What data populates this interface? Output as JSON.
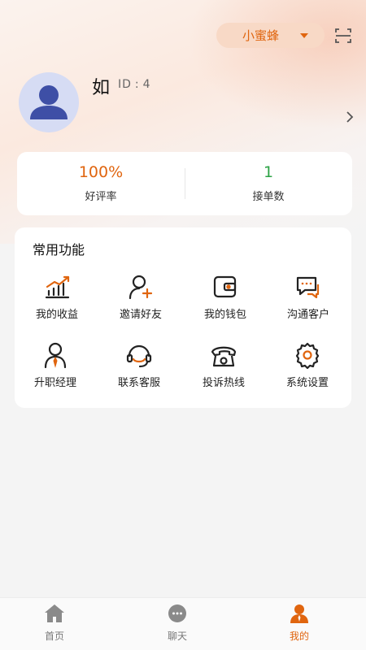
{
  "header": {
    "role_select": {
      "value": "小蜜蜂"
    },
    "scan_icon": "scan-icon"
  },
  "profile": {
    "nickname": "如",
    "id_label": "ID",
    "id_sep": ":",
    "id_value": "4"
  },
  "stats": {
    "rating": {
      "value": "100%",
      "label": "好评率"
    },
    "orders": {
      "value": "1",
      "label": "接单数"
    }
  },
  "functions": {
    "title": "常用功能",
    "items": [
      {
        "label": "我的收益",
        "icon": "income-chart-icon"
      },
      {
        "label": "邀请好友",
        "icon": "invite-user-icon"
      },
      {
        "label": "我的钱包",
        "icon": "wallet-icon"
      },
      {
        "label": "沟通客户",
        "icon": "chat-customer-icon"
      },
      {
        "label": "升职经理",
        "icon": "manager-promotion-icon"
      },
      {
        "label": "联系客服",
        "icon": "customer-service-headset-icon"
      },
      {
        "label": "投诉热线",
        "icon": "phone-icon"
      },
      {
        "label": "系统设置",
        "icon": "settings-gear-icon"
      }
    ]
  },
  "tabbar": {
    "items": [
      {
        "label": "首页",
        "icon": "home-icon"
      },
      {
        "label": "聊天",
        "icon": "chat-icon"
      },
      {
        "label": "我的",
        "icon": "profile-icon",
        "active": true
      }
    ]
  },
  "colors": {
    "accent": "#e0650f",
    "success": "#2da346",
    "avatar_bg": "#d6dcf4",
    "avatar_fg": "#3e4fa6"
  }
}
